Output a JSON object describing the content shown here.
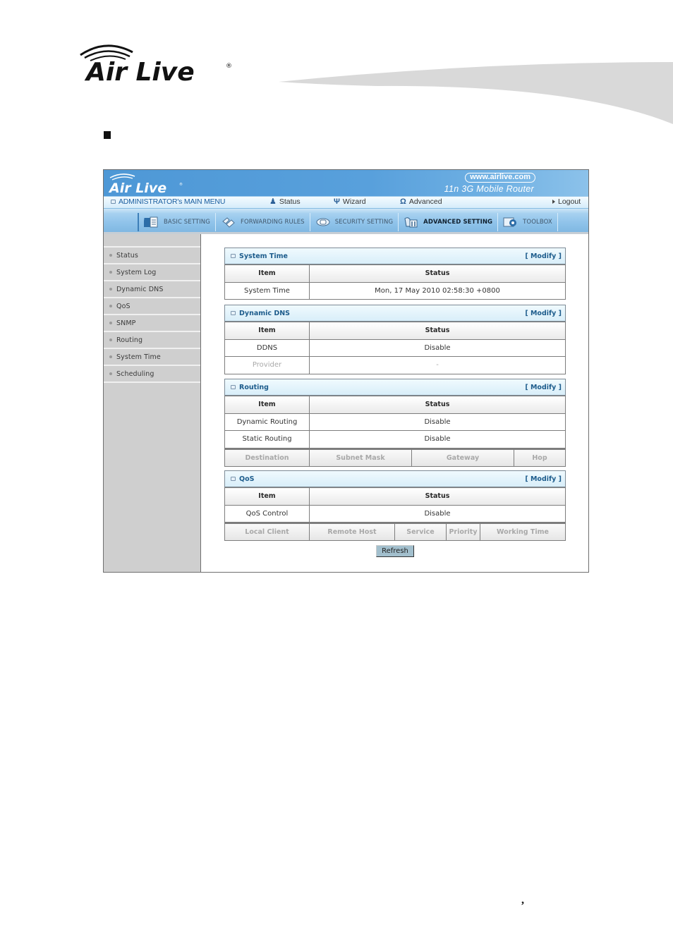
{
  "document": {
    "brand_logo": "Air Live",
    "bullet_icon": "square-bullet",
    "footer_mark": ","
  },
  "router": {
    "banner": {
      "logo": "Air Live",
      "url": "www.airlive.com",
      "product": "11n 3G Mobile Router"
    },
    "menubar": {
      "main_menu": "ADMINISTRATOR's MAIN MENU",
      "status": "Status",
      "wizard": "Wizard",
      "advanced": "Advanced",
      "logout": "Logout"
    },
    "tabs": [
      {
        "label": "BASIC SETTING",
        "icon": "document-icon",
        "active": false
      },
      {
        "label": "FORWARDING RULES",
        "icon": "forward-icon",
        "active": false
      },
      {
        "label": "SECURITY SETTING",
        "icon": "lock-icon",
        "active": false
      },
      {
        "label": "ADVANCED SETTING",
        "icon": "advanced-icon",
        "active": true
      },
      {
        "label": "TOOLBOX",
        "icon": "toolbox-icon",
        "active": false
      }
    ],
    "sidebar": {
      "items": [
        {
          "label": "Status"
        },
        {
          "label": "System Log"
        },
        {
          "label": "Dynamic DNS"
        },
        {
          "label": "QoS"
        },
        {
          "label": "SNMP"
        },
        {
          "label": "Routing"
        },
        {
          "label": "System Time"
        },
        {
          "label": "Scheduling"
        }
      ]
    },
    "panels": {
      "system_time": {
        "title": "System Time",
        "modify": "[ Modify ]",
        "headers": [
          "Item",
          "Status"
        ],
        "rows": [
          {
            "item": "System Time",
            "status": "Mon, 17 May 2010 02:58:30 +0800"
          }
        ]
      },
      "dynamic_dns": {
        "title": "Dynamic DNS",
        "modify": "[ Modify ]",
        "headers": [
          "Item",
          "Status"
        ],
        "rows": [
          {
            "item": "DDNS",
            "status": "Disable"
          },
          {
            "item": "Provider",
            "status": "-"
          }
        ]
      },
      "routing": {
        "title": "Routing",
        "modify": "[ Modify ]",
        "headers": [
          "Item",
          "Status"
        ],
        "rows": [
          {
            "item": "Dynamic Routing",
            "status": "Disable"
          },
          {
            "item": "Static Routing",
            "status": "Disable"
          }
        ],
        "sub_headers": [
          "Destination",
          "Subnet Mask",
          "Gateway",
          "Hop"
        ]
      },
      "qos": {
        "title": "QoS",
        "modify": "[ Modify ]",
        "headers": [
          "Item",
          "Status"
        ],
        "rows": [
          {
            "item": "QoS Control",
            "status": "Disable"
          }
        ],
        "sub_headers": [
          "Local Client",
          "Remote Host",
          "Service",
          "Priority",
          "Working Time"
        ]
      }
    },
    "refresh_label": "Refresh"
  }
}
